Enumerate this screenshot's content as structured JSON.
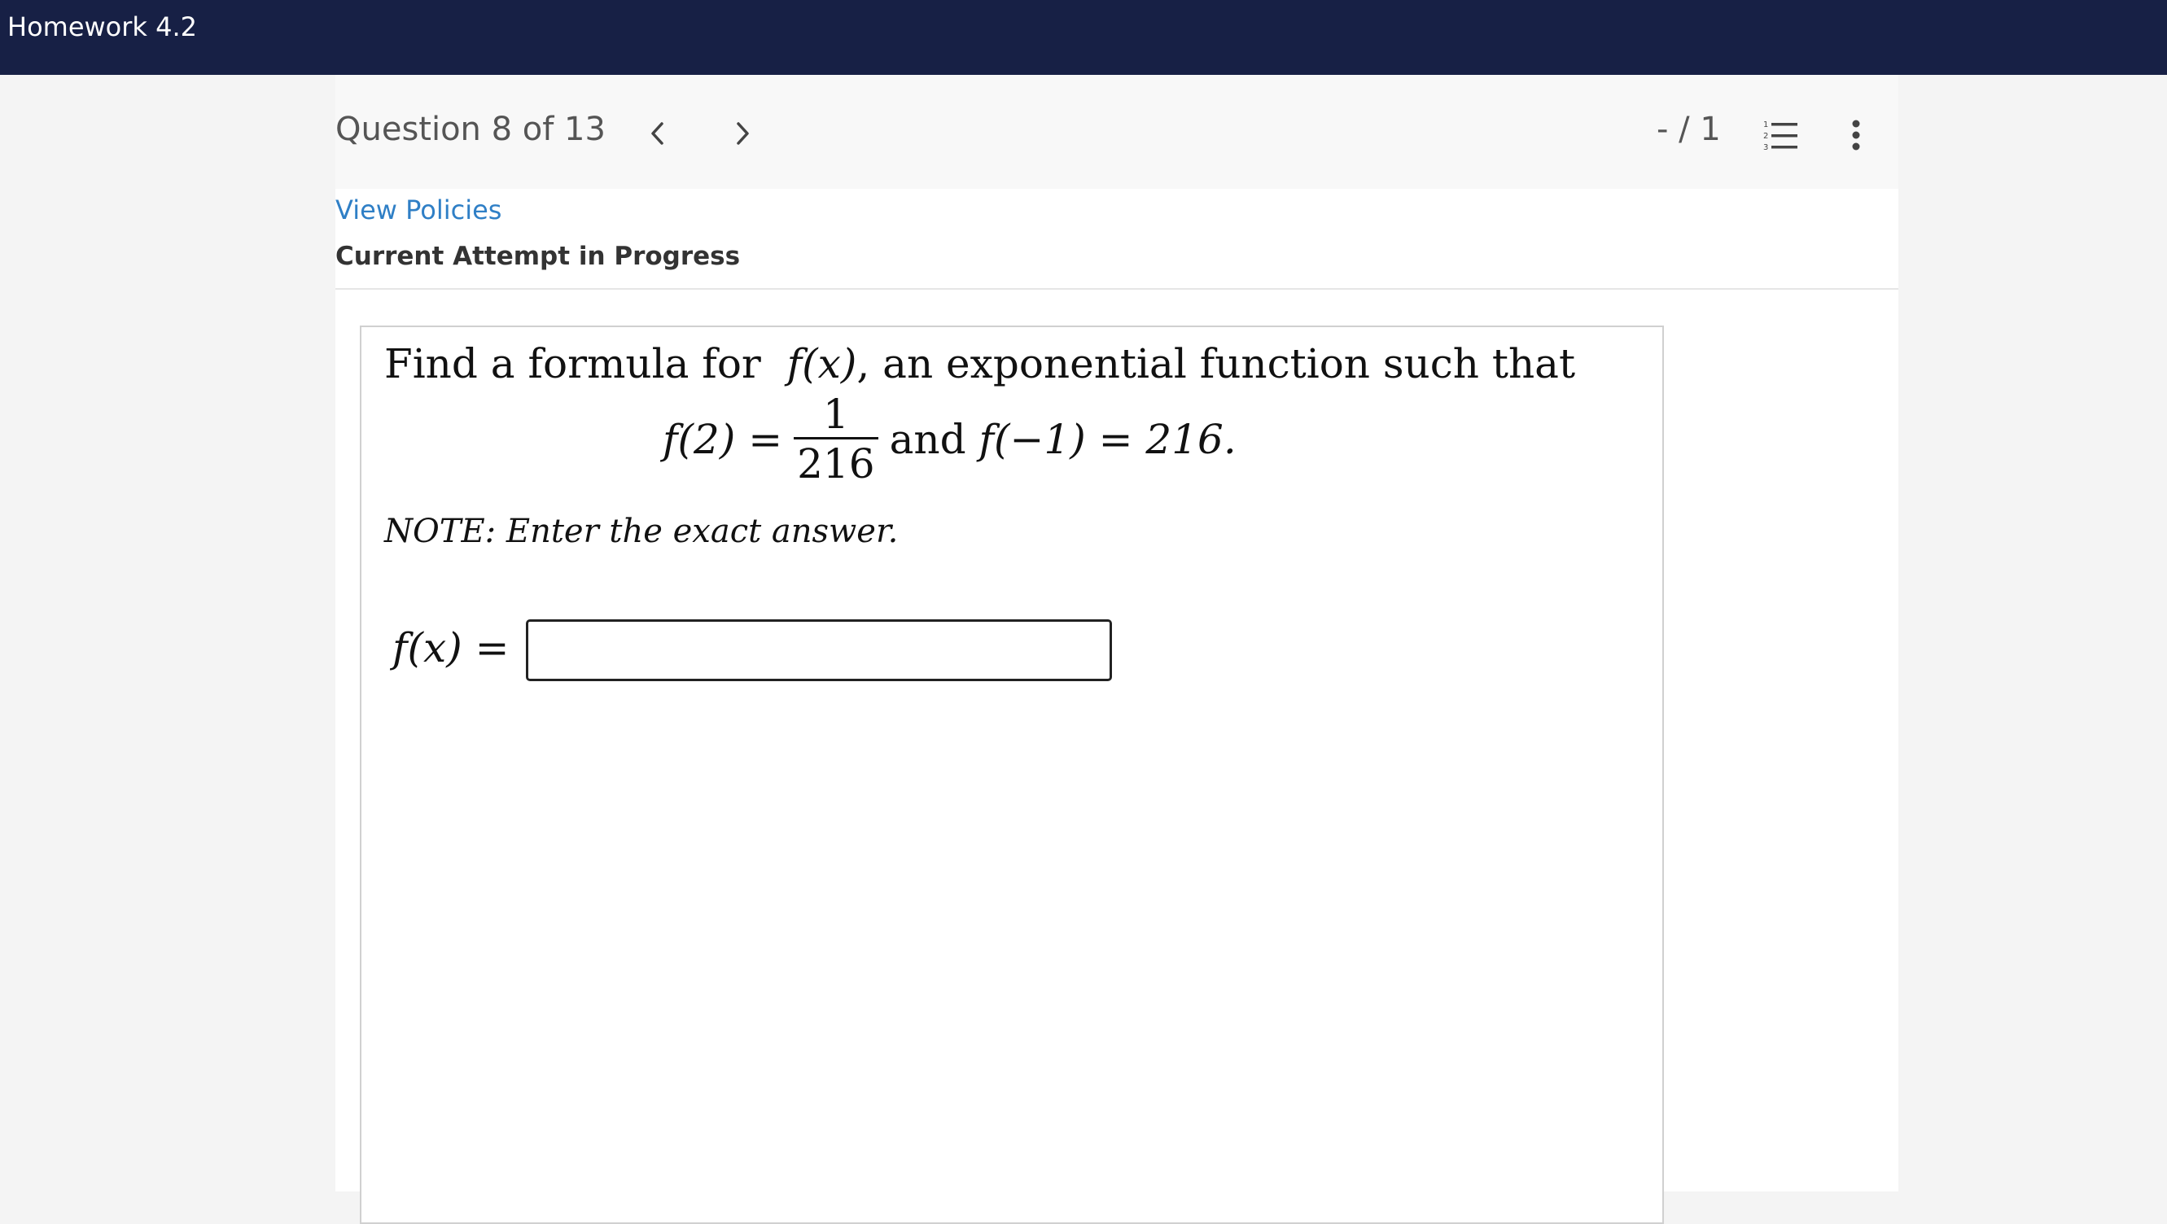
{
  "window": {
    "title": "Homework 4.2"
  },
  "header": {
    "question_label": "Question 8 of 13",
    "prev_icon": "chevron-left-icon",
    "next_icon": "chevron-right-icon",
    "score": "- / 1",
    "list_icon": "numbered-list-icon",
    "more_icon": "more-vertical-icon"
  },
  "links": {
    "view_policies": "View Policies"
  },
  "status": {
    "attempt": "Current Attempt in Progress"
  },
  "question": {
    "intro": "Find a formula for",
    "fx": "f(x)",
    "intro_rest": ", an exponential function such that",
    "f2": "f(2) =",
    "numerator": "1",
    "denominator": "216",
    "and": "and",
    "fneg1": "f(−1) = 216.",
    "note": "NOTE: Enter the exact answer.",
    "answer_label": "f(x) =",
    "answer_value": ""
  },
  "colors": {
    "topbar": "#172045",
    "link": "#2f7fc6"
  }
}
